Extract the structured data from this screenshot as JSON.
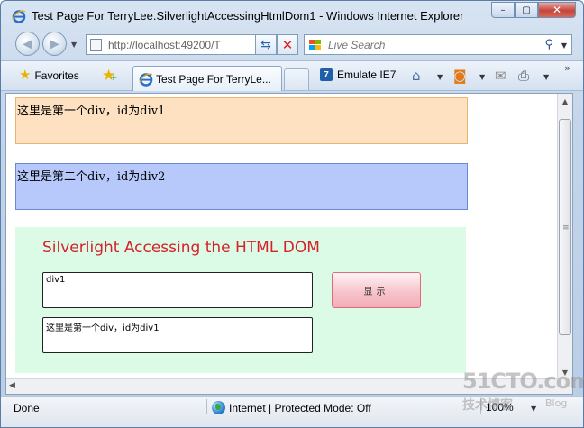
{
  "window": {
    "title": "Test Page For TerryLee.SilverlightAccessingHtmlDom1 - Windows Internet Explorer",
    "minimize": "–",
    "maximize": "▢",
    "close": "✕"
  },
  "nav": {
    "back_icon": "back-arrow-icon",
    "forward_icon": "forward-arrow-icon",
    "address": "http://localhost:49200/T",
    "search_placeholder": "Live Search"
  },
  "toolbar": {
    "favorites_label": "Favorites",
    "tab_label": "Test Page For TerryLe...",
    "emulate_badge": "7",
    "emulate_label": "Emulate IE7"
  },
  "page": {
    "div1_text": "这里是第一个div，id为div1",
    "div2_text": "这里是第二个div，id为div2",
    "silverlight_title": "Silverlight Accessing the HTML DOM",
    "input1_value": "div1",
    "input2_value": "这里是第一个div，id为div1",
    "show_button_label": "显示"
  },
  "status": {
    "text": "Done",
    "zone": "Internet | Protected Mode: Off",
    "zoom": "100%"
  },
  "watermark": {
    "site": "51CTO.com",
    "sub": "技术博客",
    "blog": "Blog"
  },
  "colors": {
    "div1_bg": "#fde1c1",
    "div2_bg": "#b7c8fb",
    "silverlight_bg": "#dcfbe6",
    "title_red": "#d4222a"
  }
}
